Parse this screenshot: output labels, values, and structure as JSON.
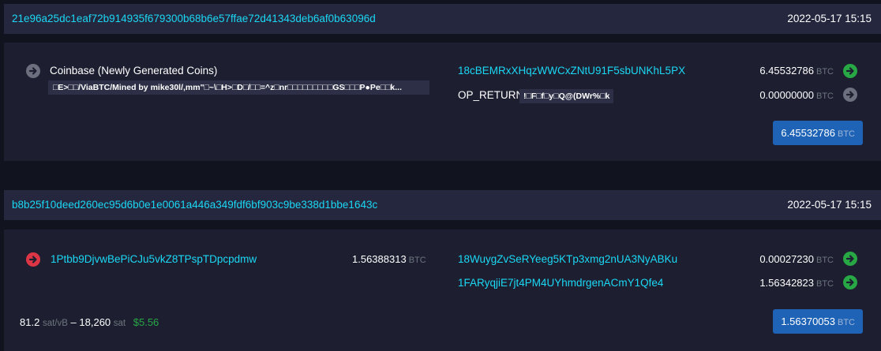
{
  "tx1": {
    "txid": "21e96a25dc1eaf72b914935f679300b68b6e57ffae72d41343deb6af0b63096d",
    "time": "2022-05-17 15:15",
    "input": {
      "label": "Coinbase (Newly Generated Coins)",
      "scriptsig": "□E>□□/ViaBTC/Mined by mike30l/,mm\"□~\\□H>□D□/□□=^z□nr□□□□□□□□□GS□□□P●Pe□□k..."
    },
    "outputs": [
      {
        "address": "18cBEMRxXHqzWWCxZNtU91F5sbUNKhL5PX",
        "amount": "6.45532786",
        "unit": "BTC",
        "icon": "arrow-right-icon",
        "status": "green"
      },
      {
        "address": "OP_RETURN",
        "data": "!□F□f□y□Q@(DWr%□k",
        "amount": "0.00000000",
        "unit": "BTC",
        "icon": "arrow-right-icon",
        "status": "grey"
      }
    ],
    "total": {
      "amount": "6.45532786",
      "unit": "BTC"
    }
  },
  "tx2": {
    "txid": "b8b25f10deed260ec95d6b0e1e0061a446a349fdf6bf903c9be338d1bbe1643c",
    "time": "2022-05-17 15:15",
    "input": {
      "address": "1Ptbb9DjvwBePiCJu5vkZ8TPspTDpcpdmw",
      "amount": "1.56388313",
      "unit": "BTC"
    },
    "outputs": [
      {
        "address": "18WuygZvSeRYeeg5KTp3xmg2nUA3NyABKu",
        "amount": "0.00027230",
        "unit": "BTC",
        "icon": "arrow-right-icon",
        "status": "green"
      },
      {
        "address": "1FARyqjiE7jt4PM4UYhmdrgenACmY1Qfe4",
        "amount": "1.56342823",
        "unit": "BTC",
        "icon": "arrow-right-icon",
        "status": "green"
      }
    ],
    "fee": {
      "rate": "81.2",
      "rate_unit": "sat/vB",
      "sep": "–",
      "size": "18,260",
      "size_unit": "sat",
      "usd": "$5.56"
    },
    "total": {
      "amount": "1.56370053",
      "unit": "BTC"
    }
  },
  "colors": {
    "link": "#1bd8f4",
    "green": "#28a745",
    "red": "#dc3545",
    "grey": "#6c6f7e",
    "button": "#1e63b5"
  }
}
